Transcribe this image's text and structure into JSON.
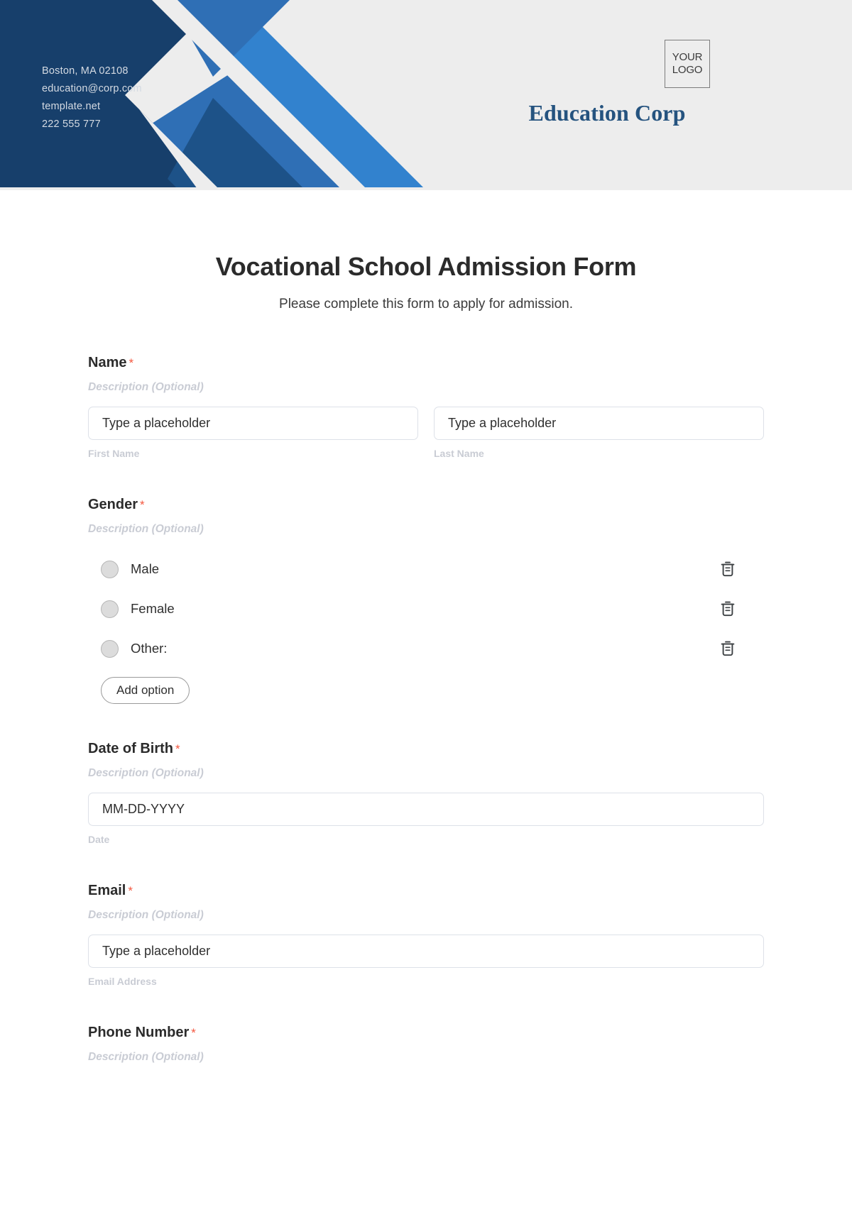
{
  "header": {
    "contact_lines": [
      "Boston, MA 02108",
      "education@corp.com",
      "template.net",
      "222 555 777"
    ],
    "logo_line1": "YOUR",
    "logo_line2": "LOGO",
    "brand_name": "Education Corp",
    "colors": {
      "background": "#ededed",
      "navy": "#173f6b",
      "bright_blue": "#3282ce",
      "mid_blue": "#2f6fb5",
      "deep_blue": "#1d5288",
      "brand_text": "#25537f"
    }
  },
  "form": {
    "title": "Vocational School Admission Form",
    "subtitle": "Please complete this form to apply for admission.",
    "required_marker": "*",
    "description_placeholder": "Description (Optional)",
    "add_option_label": "Add option",
    "fields": [
      {
        "label": "Name",
        "description": "Description (Optional)",
        "inputs": [
          {
            "value": "Type a placeholder",
            "sub_label": "First Name"
          },
          {
            "value": "Type a placeholder",
            "sub_label": "Last Name"
          }
        ]
      },
      {
        "label": "Gender",
        "description": "Description (Optional)",
        "options": [
          {
            "label": "Male",
            "delete_icon": "trash-icon"
          },
          {
            "label": "Female",
            "delete_icon": "trash-icon"
          },
          {
            "label": "Other:",
            "delete_icon": "trash-icon"
          }
        ]
      },
      {
        "label": "Date of Birth",
        "description": "Description (Optional)",
        "inputs": [
          {
            "value": "MM-DD-YYYY",
            "sub_label": "Date"
          }
        ]
      },
      {
        "label": "Email",
        "description": "Description (Optional)",
        "inputs": [
          {
            "value": "Type a placeholder",
            "sub_label": "Email Address"
          }
        ]
      },
      {
        "label": "Phone Number",
        "description": "Description (Optional)"
      }
    ]
  }
}
